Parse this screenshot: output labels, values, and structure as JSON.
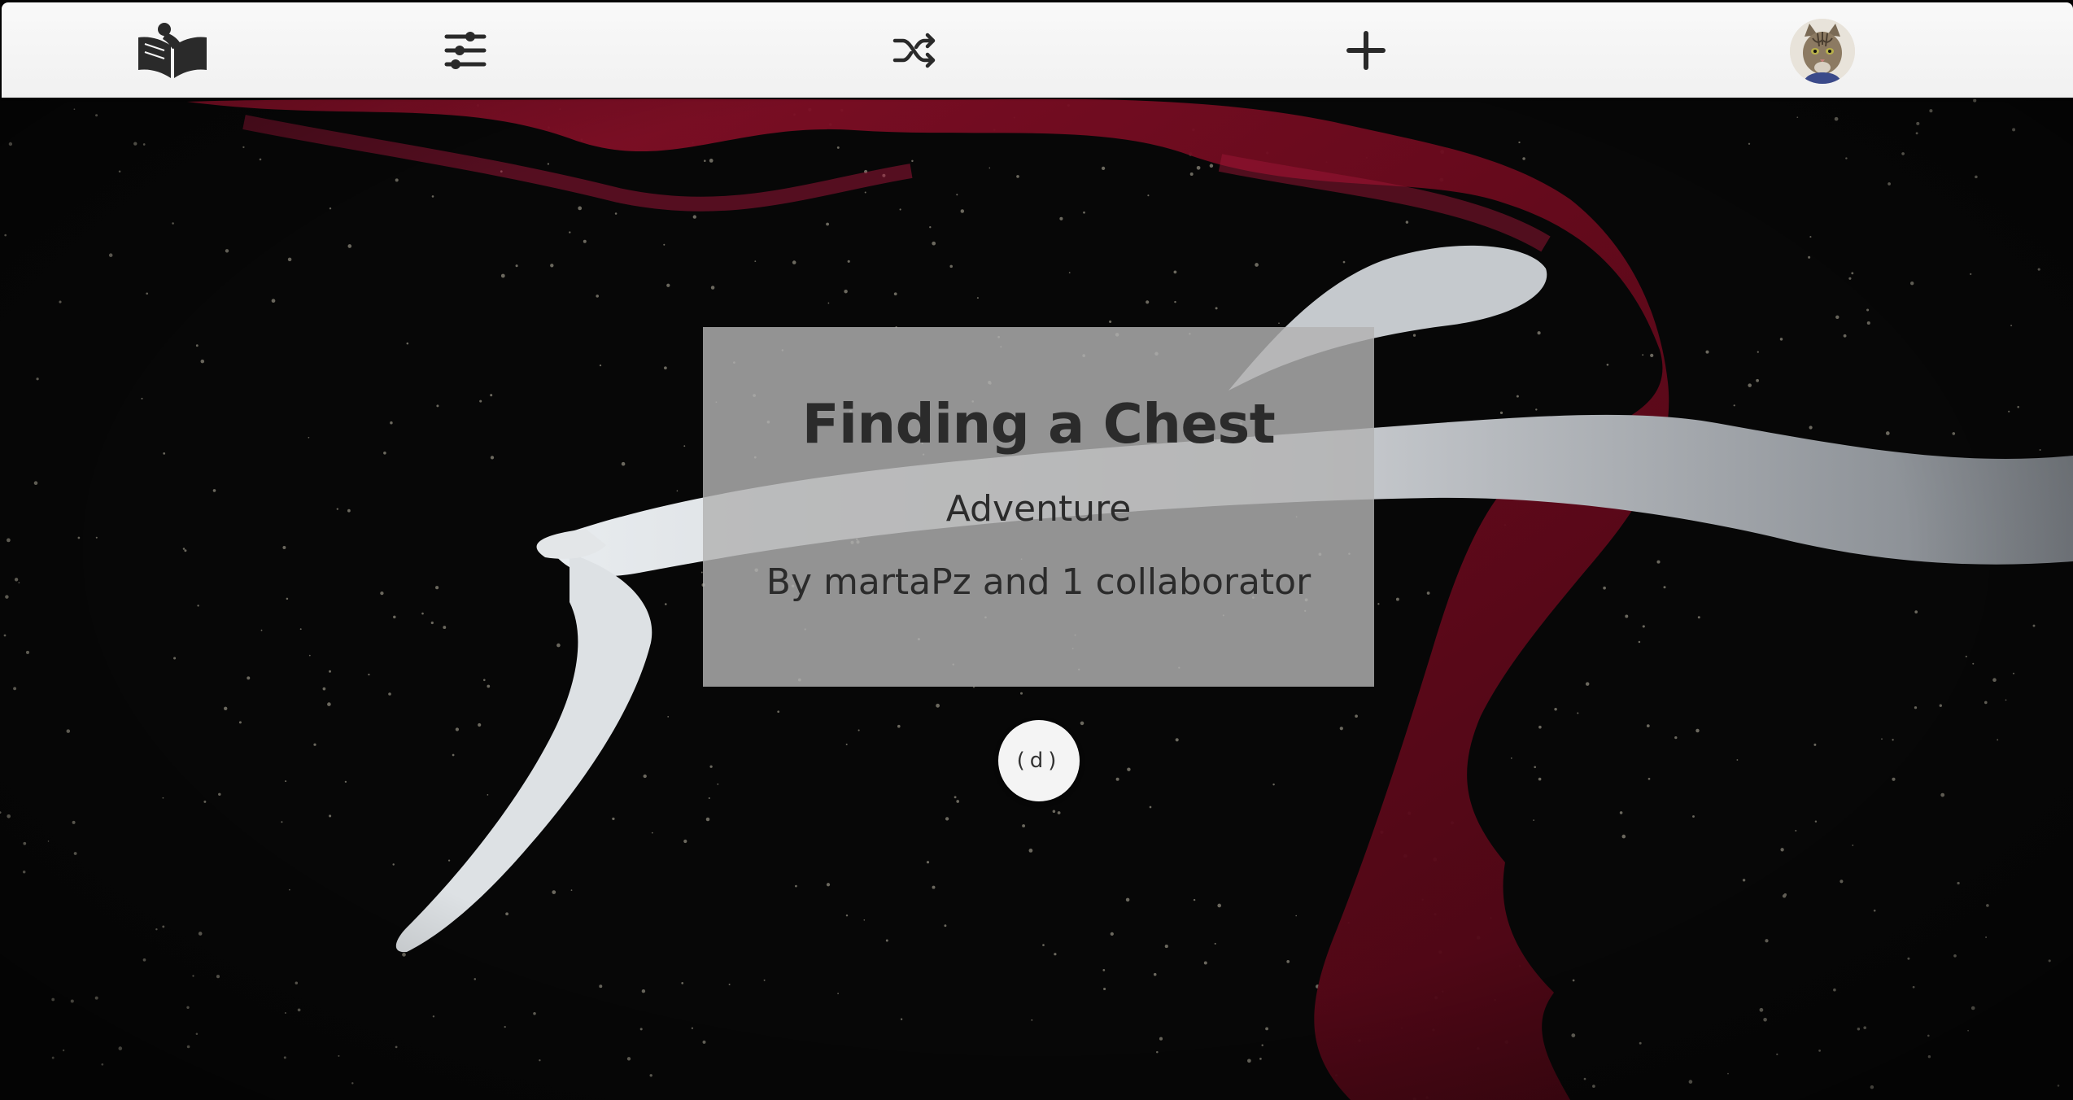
{
  "navbar": {
    "logo_icon": "open-book-reader-icon",
    "filter_icon": "sliders-icon",
    "shuffle_icon": "shuffle-icon",
    "add_icon": "plus-icon",
    "avatar": "cat-avatar"
  },
  "story": {
    "title": "Finding a Chest",
    "genre": "Adventure",
    "authors": "By martaPz and 1 collaborator"
  },
  "open_button": {
    "label": "(d)"
  },
  "colors": {
    "navbar_bg": "#f5f5f5",
    "icon_color": "#2a2a2a",
    "background": "#070707",
    "velvet_red": "#6e0a1e",
    "antler": "#b9bcbf",
    "card_bg": "#b2b2b2"
  }
}
